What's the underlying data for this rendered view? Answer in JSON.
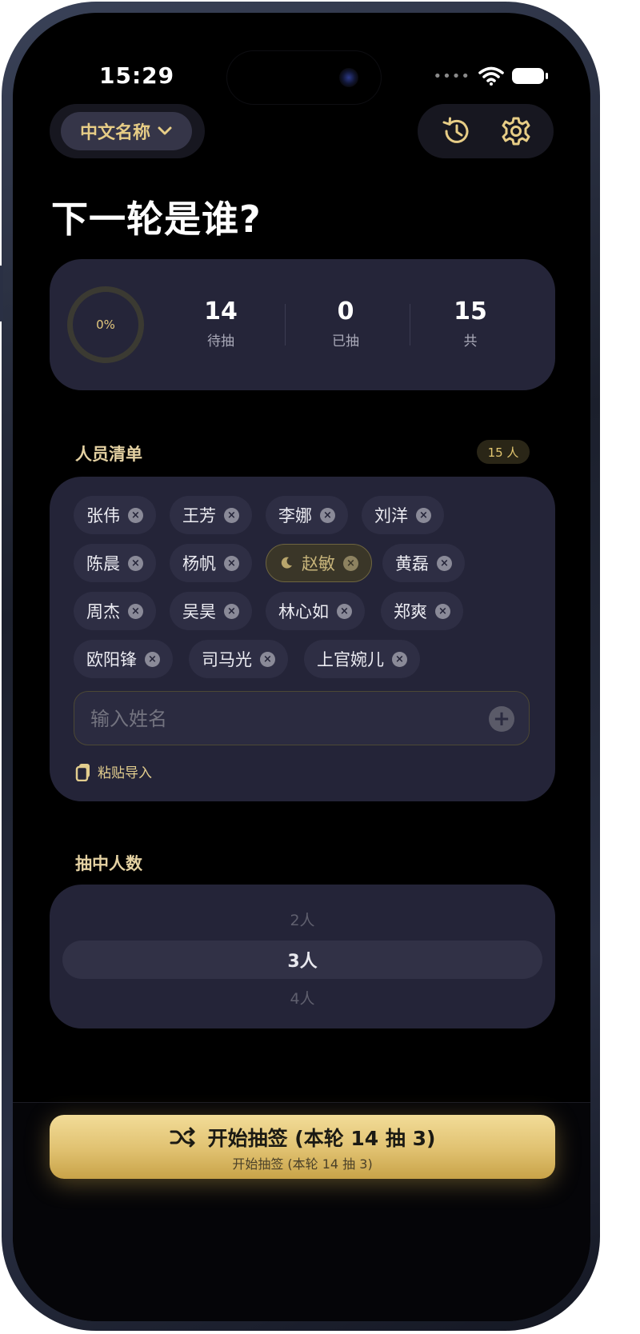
{
  "status_bar": {
    "time": "15:29",
    "signal_dots": "••••"
  },
  "header": {
    "language_label": "中文名称",
    "title": "下一轮是谁?"
  },
  "stats": {
    "progress_label": "0%",
    "progress_value": 0,
    "pending": {
      "value": "14",
      "label": "待抽"
    },
    "drawn": {
      "value": "0",
      "label": "已抽"
    },
    "total": {
      "value": "15",
      "label": "共"
    }
  },
  "roster": {
    "title": "人员清单",
    "count_badge": "15 人",
    "people": [
      "张伟",
      "王芳",
      "李娜",
      "刘洋",
      "陈晨",
      "杨帆",
      "赵敏",
      "黄磊",
      "周杰",
      "吴昊",
      "林心如",
      "郑爽",
      "欧阳锋",
      "司马光",
      "上官婉儿"
    ],
    "special_person": "赵敏",
    "input_placeholder": "输入姓名",
    "paste_label": "粘贴导入"
  },
  "draw_count": {
    "title": "抽中人数",
    "options": [
      "2人",
      "3人",
      "4人"
    ],
    "selected": "3人"
  },
  "start_button": {
    "label": "开始抽签 (本轮 14 抽 3)",
    "sublabel": "开始抽签 (本轮 14 抽 3)"
  },
  "colors": {
    "accent_gold": "#e4c97e",
    "card_bg": "#242438",
    "button_gold": "#e0c170"
  }
}
